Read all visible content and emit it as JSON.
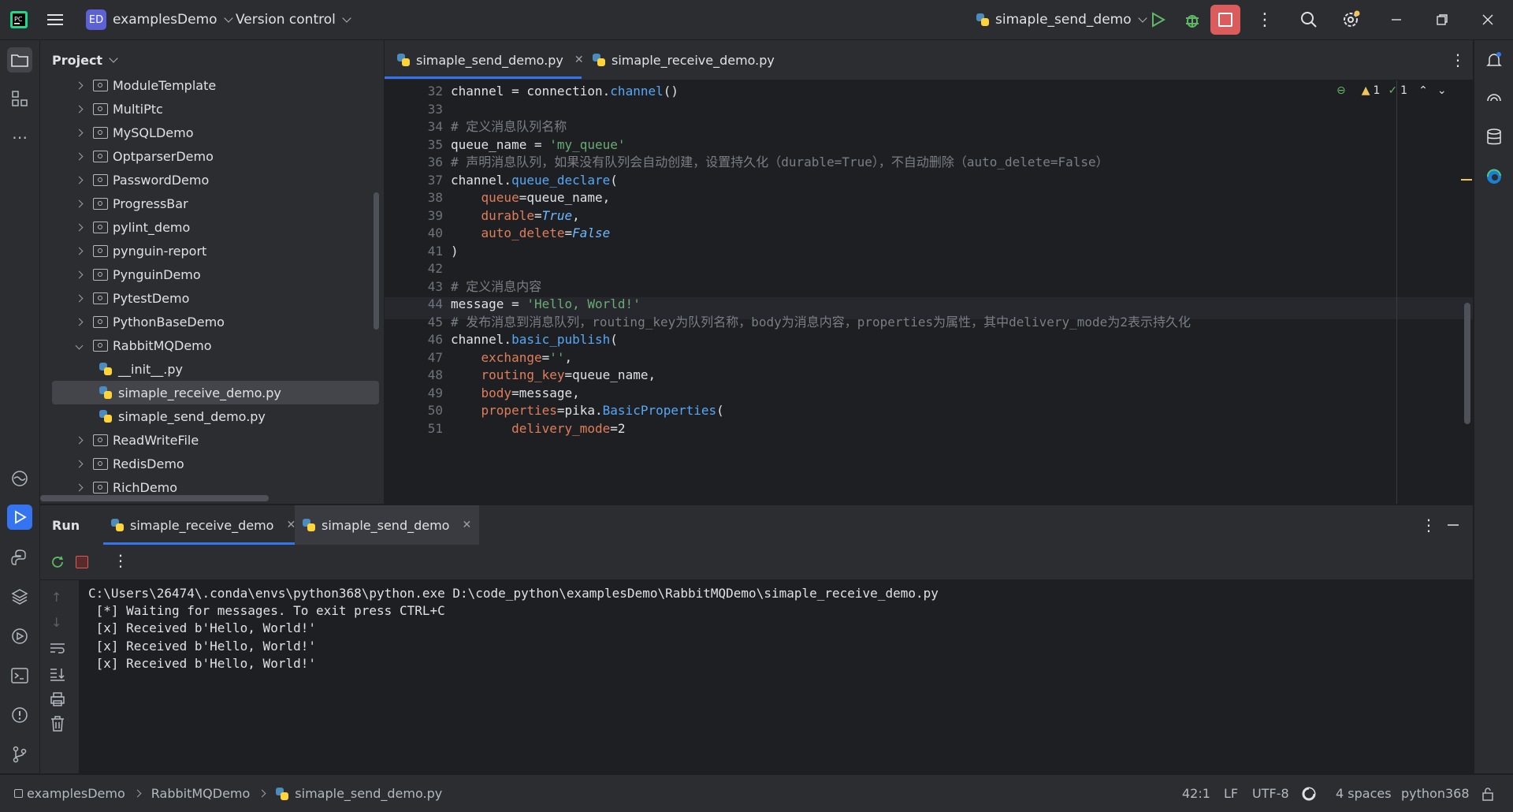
{
  "titlebar": {
    "project_badge": "ED",
    "project_name": "examplesDemo",
    "vcs": "Version control",
    "run_config": "simaple_send_demo"
  },
  "project_panel": {
    "title": "Project",
    "items": [
      {
        "label": "ModuleTemplate",
        "type": "folder"
      },
      {
        "label": "MultiPtc",
        "type": "folder"
      },
      {
        "label": "MySQLDemo",
        "type": "folder"
      },
      {
        "label": "OptparserDemo",
        "type": "folder"
      },
      {
        "label": "PasswordDemo",
        "type": "folder"
      },
      {
        "label": "ProgressBar",
        "type": "folder"
      },
      {
        "label": "pylint_demo",
        "type": "folder"
      },
      {
        "label": "pynguin-report",
        "type": "folder"
      },
      {
        "label": "PynguinDemo",
        "type": "folder"
      },
      {
        "label": "PytestDemo",
        "type": "folder"
      },
      {
        "label": "PythonBaseDemo",
        "type": "folder"
      },
      {
        "label": "RabbitMQDemo",
        "type": "folder-open"
      },
      {
        "label": "__init__.py",
        "type": "file"
      },
      {
        "label": "simaple_receive_demo.py",
        "type": "file",
        "selected": true
      },
      {
        "label": "simaple_send_demo.py",
        "type": "file"
      },
      {
        "label": "ReadWriteFile",
        "type": "folder"
      },
      {
        "label": "RedisDemo",
        "type": "folder"
      },
      {
        "label": "RichDemo",
        "type": "folder"
      }
    ]
  },
  "editor": {
    "tabs": [
      {
        "label": "simaple_send_demo.py",
        "active": true
      },
      {
        "label": "simaple_receive_demo.py",
        "active": false
      }
    ],
    "inspections": {
      "warnings": "1",
      "ok": "1"
    },
    "lines": [
      {
        "n": "32",
        "code": "channel = connection.channel()"
      },
      {
        "n": "33",
        "code": ""
      },
      {
        "n": "34",
        "code": "# 定义消息队列名称"
      },
      {
        "n": "35",
        "code": "queue_name = 'my_queue'"
      },
      {
        "n": "36",
        "code": "# 声明消息队列，如果没有队列会自动创建，设置持久化（durable=True），不自动删除（auto_delete=False）"
      },
      {
        "n": "37",
        "code": "channel.queue_declare("
      },
      {
        "n": "38",
        "code": "    queue=queue_name,"
      },
      {
        "n": "39",
        "code": "    durable=True,"
      },
      {
        "n": "40",
        "code": "    auto_delete=False"
      },
      {
        "n": "41",
        "code": ")"
      },
      {
        "n": "42",
        "code": ""
      },
      {
        "n": "43",
        "code": "# 定义消息内容"
      },
      {
        "n": "44",
        "code": "message = 'Hello, World!'"
      },
      {
        "n": "45",
        "code": "# 发布消息到消息队列，routing_key为队列名称，body为消息内容，properties为属性，其中delivery_mode为2表示持久化"
      },
      {
        "n": "46",
        "code": "channel.basic_publish("
      },
      {
        "n": "47",
        "code": "    exchange='',"
      },
      {
        "n": "48",
        "code": "    routing_key=queue_name,"
      },
      {
        "n": "49",
        "code": "    body=message,"
      },
      {
        "n": "50",
        "code": "    properties=pika.BasicProperties("
      },
      {
        "n": "51",
        "code": "        delivery_mode=2"
      }
    ]
  },
  "run_panel": {
    "title": "Run",
    "tabs": [
      {
        "label": "simaple_receive_demo",
        "active": true
      },
      {
        "label": "simaple_send_demo",
        "active": false
      }
    ],
    "output": [
      "C:\\Users\\26474\\.conda\\envs\\python368\\python.exe D:\\code_python\\examplesDemo\\RabbitMQDemo\\simaple_receive_demo.py",
      " [*] Waiting for messages. To exit press CTRL+C",
      " [x] Received b'Hello, World!'",
      " [x] Received b'Hello, World!'",
      " [x] Received b'Hello, World!'"
    ]
  },
  "statusbar": {
    "breadcrumb": [
      "examplesDemo",
      "RabbitMQDemo",
      "simaple_send_demo.py"
    ],
    "position": "42:1",
    "line_sep": "LF",
    "encoding": "UTF-8",
    "indent": "4 spaces",
    "interpreter": "python368"
  },
  "colors": {
    "accent": "#3574f0",
    "stop": "#db5c5c",
    "run": "#5fb865"
  }
}
